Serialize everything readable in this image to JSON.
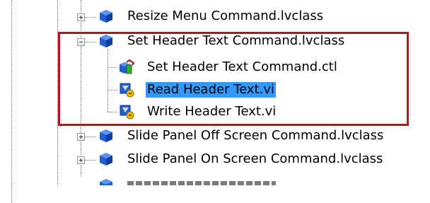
{
  "tree": {
    "items": [
      {
        "label": "Resize Menu Command.lvclass",
        "icon": "lvclass-cube-icon",
        "expanded": false
      },
      {
        "label": "Set Header Text Command.lvclass",
        "icon": "lvclass-cube-icon",
        "expanded": true
      },
      {
        "label": "Set Header Text Command.ctl",
        "icon": "ctl-typedef-icon"
      },
      {
        "label": "Read Header Text.vi",
        "icon": "member-vi-icon",
        "selected": true
      },
      {
        "label": "Write Header Text.vi",
        "icon": "member-vi-icon"
      },
      {
        "label": "Slide Panel Off Screen Command.lvclass",
        "icon": "lvclass-cube-icon",
        "expanded": false
      },
      {
        "label": "Slide Panel On Screen Command.lvclass",
        "icon": "lvclass-cube-icon",
        "expanded": false
      }
    ]
  },
  "colors": {
    "selection": "#3399ff",
    "highlight_border": "#c0101e",
    "class_cube": "#1f5fd1"
  }
}
